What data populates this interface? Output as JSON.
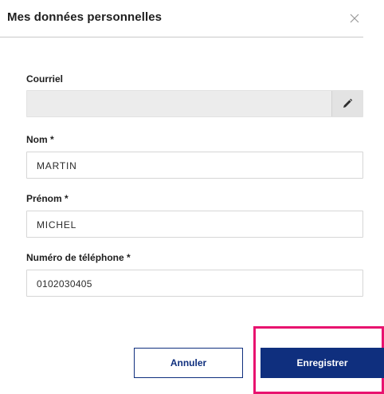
{
  "dialog": {
    "title": "Mes données personnelles",
    "close_icon": "close-icon"
  },
  "form": {
    "email": {
      "label": "Courriel",
      "value": "",
      "edit_icon": "pencil-icon"
    },
    "last_name": {
      "label": "Nom *",
      "value": "MARTIN"
    },
    "first_name": {
      "label": "Prénom *",
      "value": "MICHEL"
    },
    "phone": {
      "label": "Numéro de téléphone *",
      "value": "0102030405"
    }
  },
  "actions": {
    "cancel_label": "Annuler",
    "save_label": "Enregistrer"
  },
  "colors": {
    "primary": "#0f2f7e",
    "highlight": "#e8136f",
    "readonly_bg": "#ececec"
  }
}
